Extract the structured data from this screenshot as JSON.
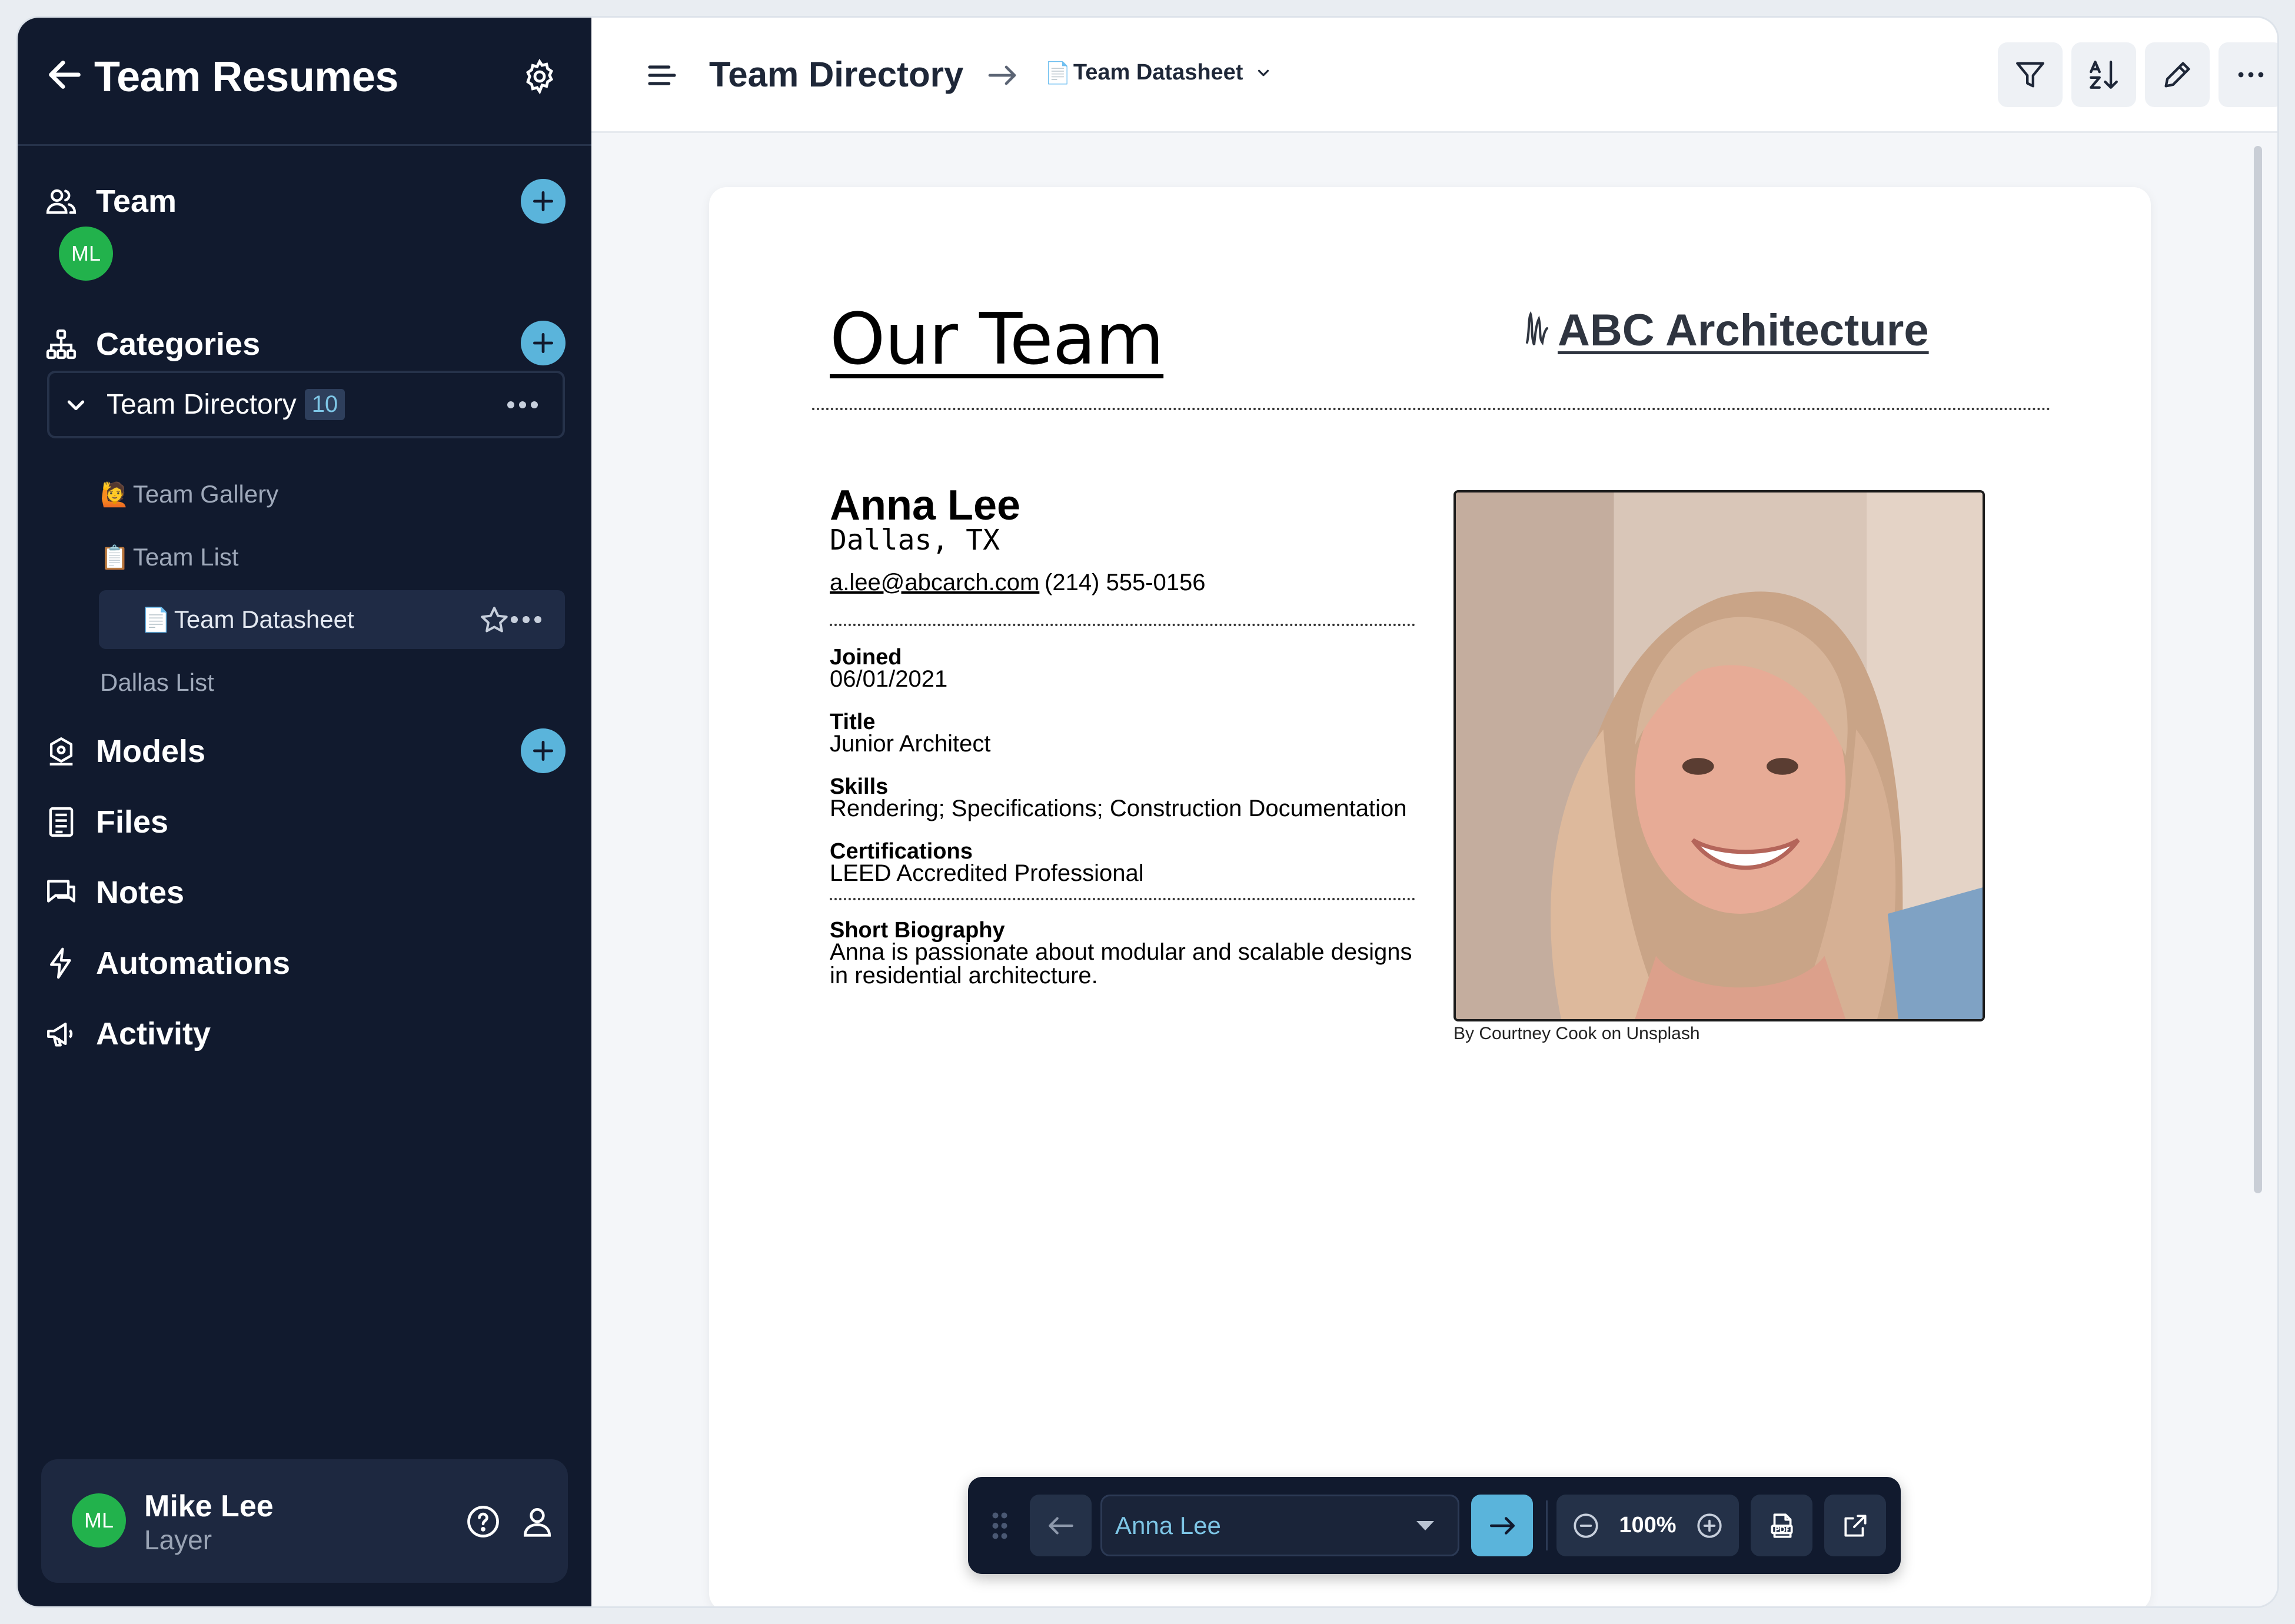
{
  "sidebar": {
    "title": "Team Resumes",
    "sections": {
      "team": "Team",
      "categories": "Categories",
      "models": "Models",
      "files": "Files",
      "notes": "Notes",
      "automations": "Automations",
      "activity": "Activity"
    },
    "team_member_initials": "ML",
    "tree": {
      "root_label": "Team Directory",
      "root_count": "10",
      "items": [
        {
          "emoji": "🙋",
          "label": "Team Gallery"
        },
        {
          "emoji": "📋",
          "label": "Team List"
        },
        {
          "emoji": "📄",
          "label": "Team Datasheet",
          "active": true
        },
        {
          "emoji": "",
          "label": "Dallas List"
        }
      ]
    },
    "user": {
      "initials": "ML",
      "name": "Mike Lee",
      "org": "Layer"
    }
  },
  "topbar": {
    "breadcrumb_root": "Team Directory",
    "current_view_emoji": "📄",
    "current_view": "Team Datasheet",
    "icons": [
      "filter-icon",
      "sort-az-icon",
      "edit-pencil-icon",
      "more-icon"
    ]
  },
  "document": {
    "heading": "Our Team",
    "company": "ABC Architecture",
    "person": {
      "name": "Anna Lee",
      "location": "Dallas, TX",
      "email": "a.lee@abcarch.com",
      "phone": "(214) 555-0156"
    },
    "fields": [
      {
        "label": "Joined",
        "value": "06/01/2021"
      },
      {
        "label": "Title",
        "value": "Junior Architect"
      },
      {
        "label": "Skills",
        "value": "Rendering; Specifications; Construction Documentation"
      },
      {
        "label": "Certifications",
        "value": "LEED Accredited Professional"
      },
      {
        "label": "Short Biography",
        "value": "Anna is passionate about modular and scalable designs in residential architecture."
      }
    ],
    "photo_credit": "By Courtney Cook on Unsplash"
  },
  "toolbar": {
    "record_select": "Anna Lee",
    "zoom": "100%"
  },
  "colors": {
    "sidebar_bg": "#111a2e",
    "accent": "#5ab4db",
    "avatar_green": "#22b24c"
  }
}
